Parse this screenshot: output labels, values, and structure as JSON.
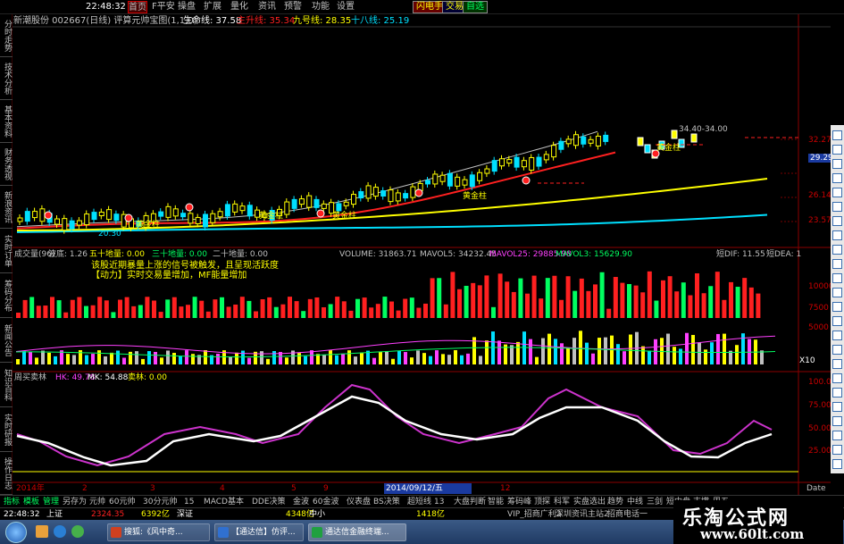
{
  "topbar": {
    "clock": "22:48:32",
    "nav": [
      "首页",
      "F平安",
      "操盘",
      "扩展",
      "量化",
      "资讯",
      "预警",
      "功能",
      "设置"
    ],
    "right_buttons": [
      "闪电手",
      "交易",
      "自选"
    ],
    "active_nav_index": 0
  },
  "colors": {
    "up": "#ff2020",
    "down": "#00ff60",
    "yellow": "#ffff00",
    "magenta": "#ff40ff",
    "cyan": "#00e0ff",
    "axis": "#cc0000",
    "white": "#ffffff"
  },
  "left_tabs": [
    "分时走势",
    "技术分析",
    "基本资料",
    "财务透视",
    "新浪资讯",
    "实时订单",
    "筹码分布",
    "新闻公告",
    "知识百科",
    "实时研报",
    "操作日志"
  ],
  "main_panel": {
    "title": "新潮股份 002667(日线) 评算元帅宝图(1,1,0)",
    "line_labels": [
      {
        "text": "生命线: 37.58",
        "color": "#ffffff"
      },
      {
        "text": "主升线: 35.34",
        "color": "#ff2020"
      },
      {
        "text": "九号线: 28.35",
        "color": "#ffff00"
      },
      {
        "text": "十八线: 25.19",
        "color": "#00e0ff"
      }
    ],
    "axis": [
      "32.27",
      "29.29",
      "26.14",
      "23.57"
    ],
    "highlight_price": "29.29",
    "annotations": [
      "黄金柱",
      "黄金柱",
      "黄金柱",
      "黄金柱",
      "黄金柱"
    ],
    "top_right_text": "34.40-34.00",
    "low_label": "20.30"
  },
  "volume_panel": {
    "labels": [
      {
        "text": "成交量(96)",
        "color": "#c0c0c0"
      },
      {
        "text": "波底: 1.26",
        "color": "#c0c0c0"
      },
      {
        "text": "五十地量: 0.00",
        "color": "#ffff00"
      },
      {
        "text": "三十地量: 0.00",
        "color": "#00ff60"
      },
      {
        "text": "二十地量: 0.00",
        "color": "#c0c0c0"
      },
      {
        "text": "VOLUME: 31863.71",
        "color": "#c0c0c0"
      },
      {
        "text": "MAVOL5: 34232.45",
        "color": "#c0c0c0"
      },
      {
        "text": "MAVOL25: 29885.98",
        "color": "#ff40ff"
      },
      {
        "text": "MAVOL3: 15629.90",
        "color": "#00ff60"
      }
    ],
    "right_labels": [
      "短DIF: 11.55",
      "短DEA: 1"
    ],
    "note_lines": [
      "该股近期暴量上涨的信号被触发，且呈现活跃度",
      "【动力】实时交易量增加，MF能量增加"
    ],
    "axis": [
      "10000",
      "7500",
      "5000"
    ],
    "unit": "X10"
  },
  "kdj_panel": {
    "labels": [
      {
        "text": "周买卖林",
        "color": "#c0c0c0"
      },
      {
        "text": "HK: 49.78",
        "color": "#ff40ff"
      },
      {
        "text": "MK: 54.88",
        "color": "#ffffff"
      },
      {
        "text": "卖林: 0.00",
        "color": "#ffff00"
      }
    ],
    "axis": [
      "100.0",
      "75.00",
      "50.00",
      "25.00"
    ]
  },
  "date_axis": {
    "labels": [
      "2014年",
      "2",
      "3",
      "4",
      "5",
      "9",
      "2014/09/12/五",
      "12"
    ],
    "right": "Date"
  },
  "bottom_tabs": [
    "指标",
    "模板",
    "管理",
    "另存为",
    "元帅",
    "60元帅",
    "30分元帅",
    "15",
    "MACD基本",
    "DDE决策",
    "金波",
    "60金波",
    "仪表盘",
    "BS决策",
    "超短线",
    "13",
    "大盘判断",
    "智能",
    "筹码峰",
    "顶探",
    "科军",
    "实盘选出",
    "趋势",
    "中线",
    "三剑",
    "短中盘",
    "支撑",
    "周五"
  ],
  "status": {
    "time": "22:48:32",
    "items": [
      "上证",
      "2324.35",
      "6392亿",
      "深证",
      "4348亿",
      "中小",
      "1418亿",
      "VIP_招商广利2",
      "深圳资讯主站2",
      "招商电话一"
    ]
  },
  "taskbar": [
    {
      "text": "搜狐:《风中奇...",
      "icon": "#d04020"
    },
    {
      "text": "【通达信】仿评...",
      "icon": "#3070d0"
    },
    {
      "text": "通达信金融终端...",
      "icon": "#20a040",
      "active": true
    }
  ],
  "watermark": {
    "line1": "乐淘公式网",
    "line2": "www.60lt.com"
  }
}
